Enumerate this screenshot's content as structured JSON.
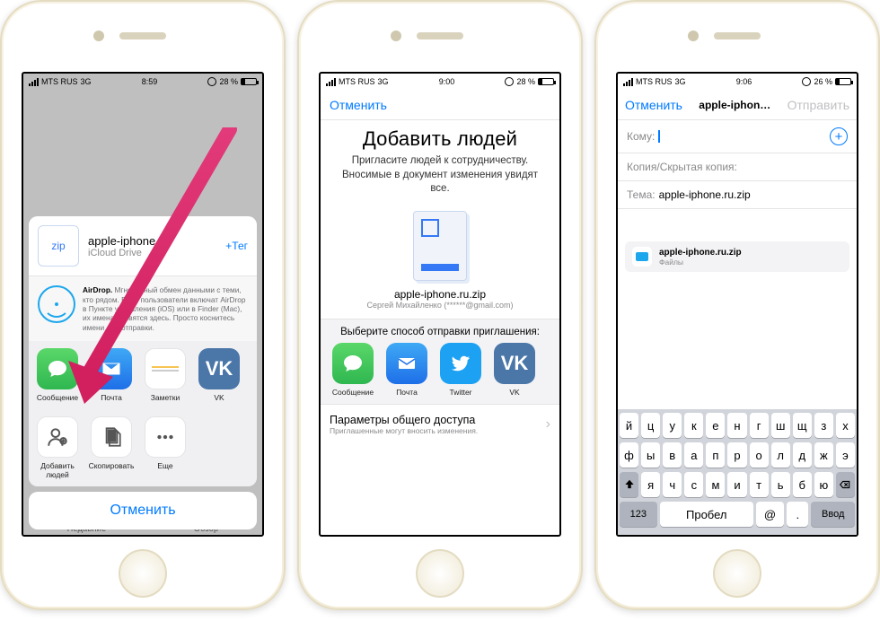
{
  "status": {
    "carrier": "MTS RUS",
    "network": "3G",
    "batteryPercent": "28 %",
    "batteryPercent3": "26 %",
    "time1": "8:59",
    "time2": "9:00",
    "time3": "9:06"
  },
  "s1": {
    "fileName": "apple-iphone.ru",
    "fileSource": "iCloud Drive",
    "zipLabel": "zip",
    "tagAction": "+Тег",
    "airdropTitle": "AirDrop.",
    "airdropBody": "Мгновенный обмен данными с теми, кто рядом. Если пользователи включат AirDrop в Пункте управления (iOS) или в Finder (Mac), их имена появятся здесь. Просто коснитесь имени для отправки.",
    "apps": [
      {
        "label": "Сообщение"
      },
      {
        "label": "Почта"
      },
      {
        "label": "Заметки"
      },
      {
        "label": "VK"
      }
    ],
    "actions": [
      {
        "label": "Добавить людей"
      },
      {
        "label": "Скопировать"
      },
      {
        "label": "Еще"
      }
    ],
    "cancel": "Отменить",
    "underlay": {
      "left": "Недавние",
      "right": "Обзор"
    }
  },
  "s2": {
    "cancel": "Отменить",
    "title": "Добавить людей",
    "subtitle": "Пригласите людей к сотрудничеству. Вносимые в документ изменения увидят все.",
    "docName": "apple-iphone.ru.zip",
    "owner": "Сергей Михайленко (******@gmail.com)",
    "section": "Выберите способ отправки приглашения:",
    "apps": [
      {
        "label": "Сообщение"
      },
      {
        "label": "Почта"
      },
      {
        "label": "Twitter"
      },
      {
        "label": "VK"
      }
    ],
    "paramsTitle": "Параметры общего доступа",
    "paramsSub": "Приглашенные могут вносить изменения."
  },
  "s3": {
    "cancel": "Отменить",
    "title": "apple-iphon…",
    "send": "Отправить",
    "toLabel": "Кому:",
    "ccLabel": "Копия/Скрытая копия:",
    "subjectLabel": "Тема:",
    "subjectValue": "apple-iphone.ru.zip",
    "attachName": "apple-iphone.ru.zip",
    "attachType": "Файлы"
  },
  "keyboard": {
    "row1": [
      "й",
      "ц",
      "у",
      "к",
      "е",
      "н",
      "г",
      "ш",
      "щ",
      "з",
      "х"
    ],
    "row2": [
      "ф",
      "ы",
      "в",
      "а",
      "п",
      "р",
      "о",
      "л",
      "д",
      "ж",
      "э"
    ],
    "row3": [
      "я",
      "ч",
      "с",
      "м",
      "и",
      "т",
      "ь",
      "б",
      "ю"
    ],
    "numKey": "123",
    "spaceKey": "Пробел",
    "atKey": "@",
    "dotKey": ".",
    "enterKey": "Ввод"
  }
}
